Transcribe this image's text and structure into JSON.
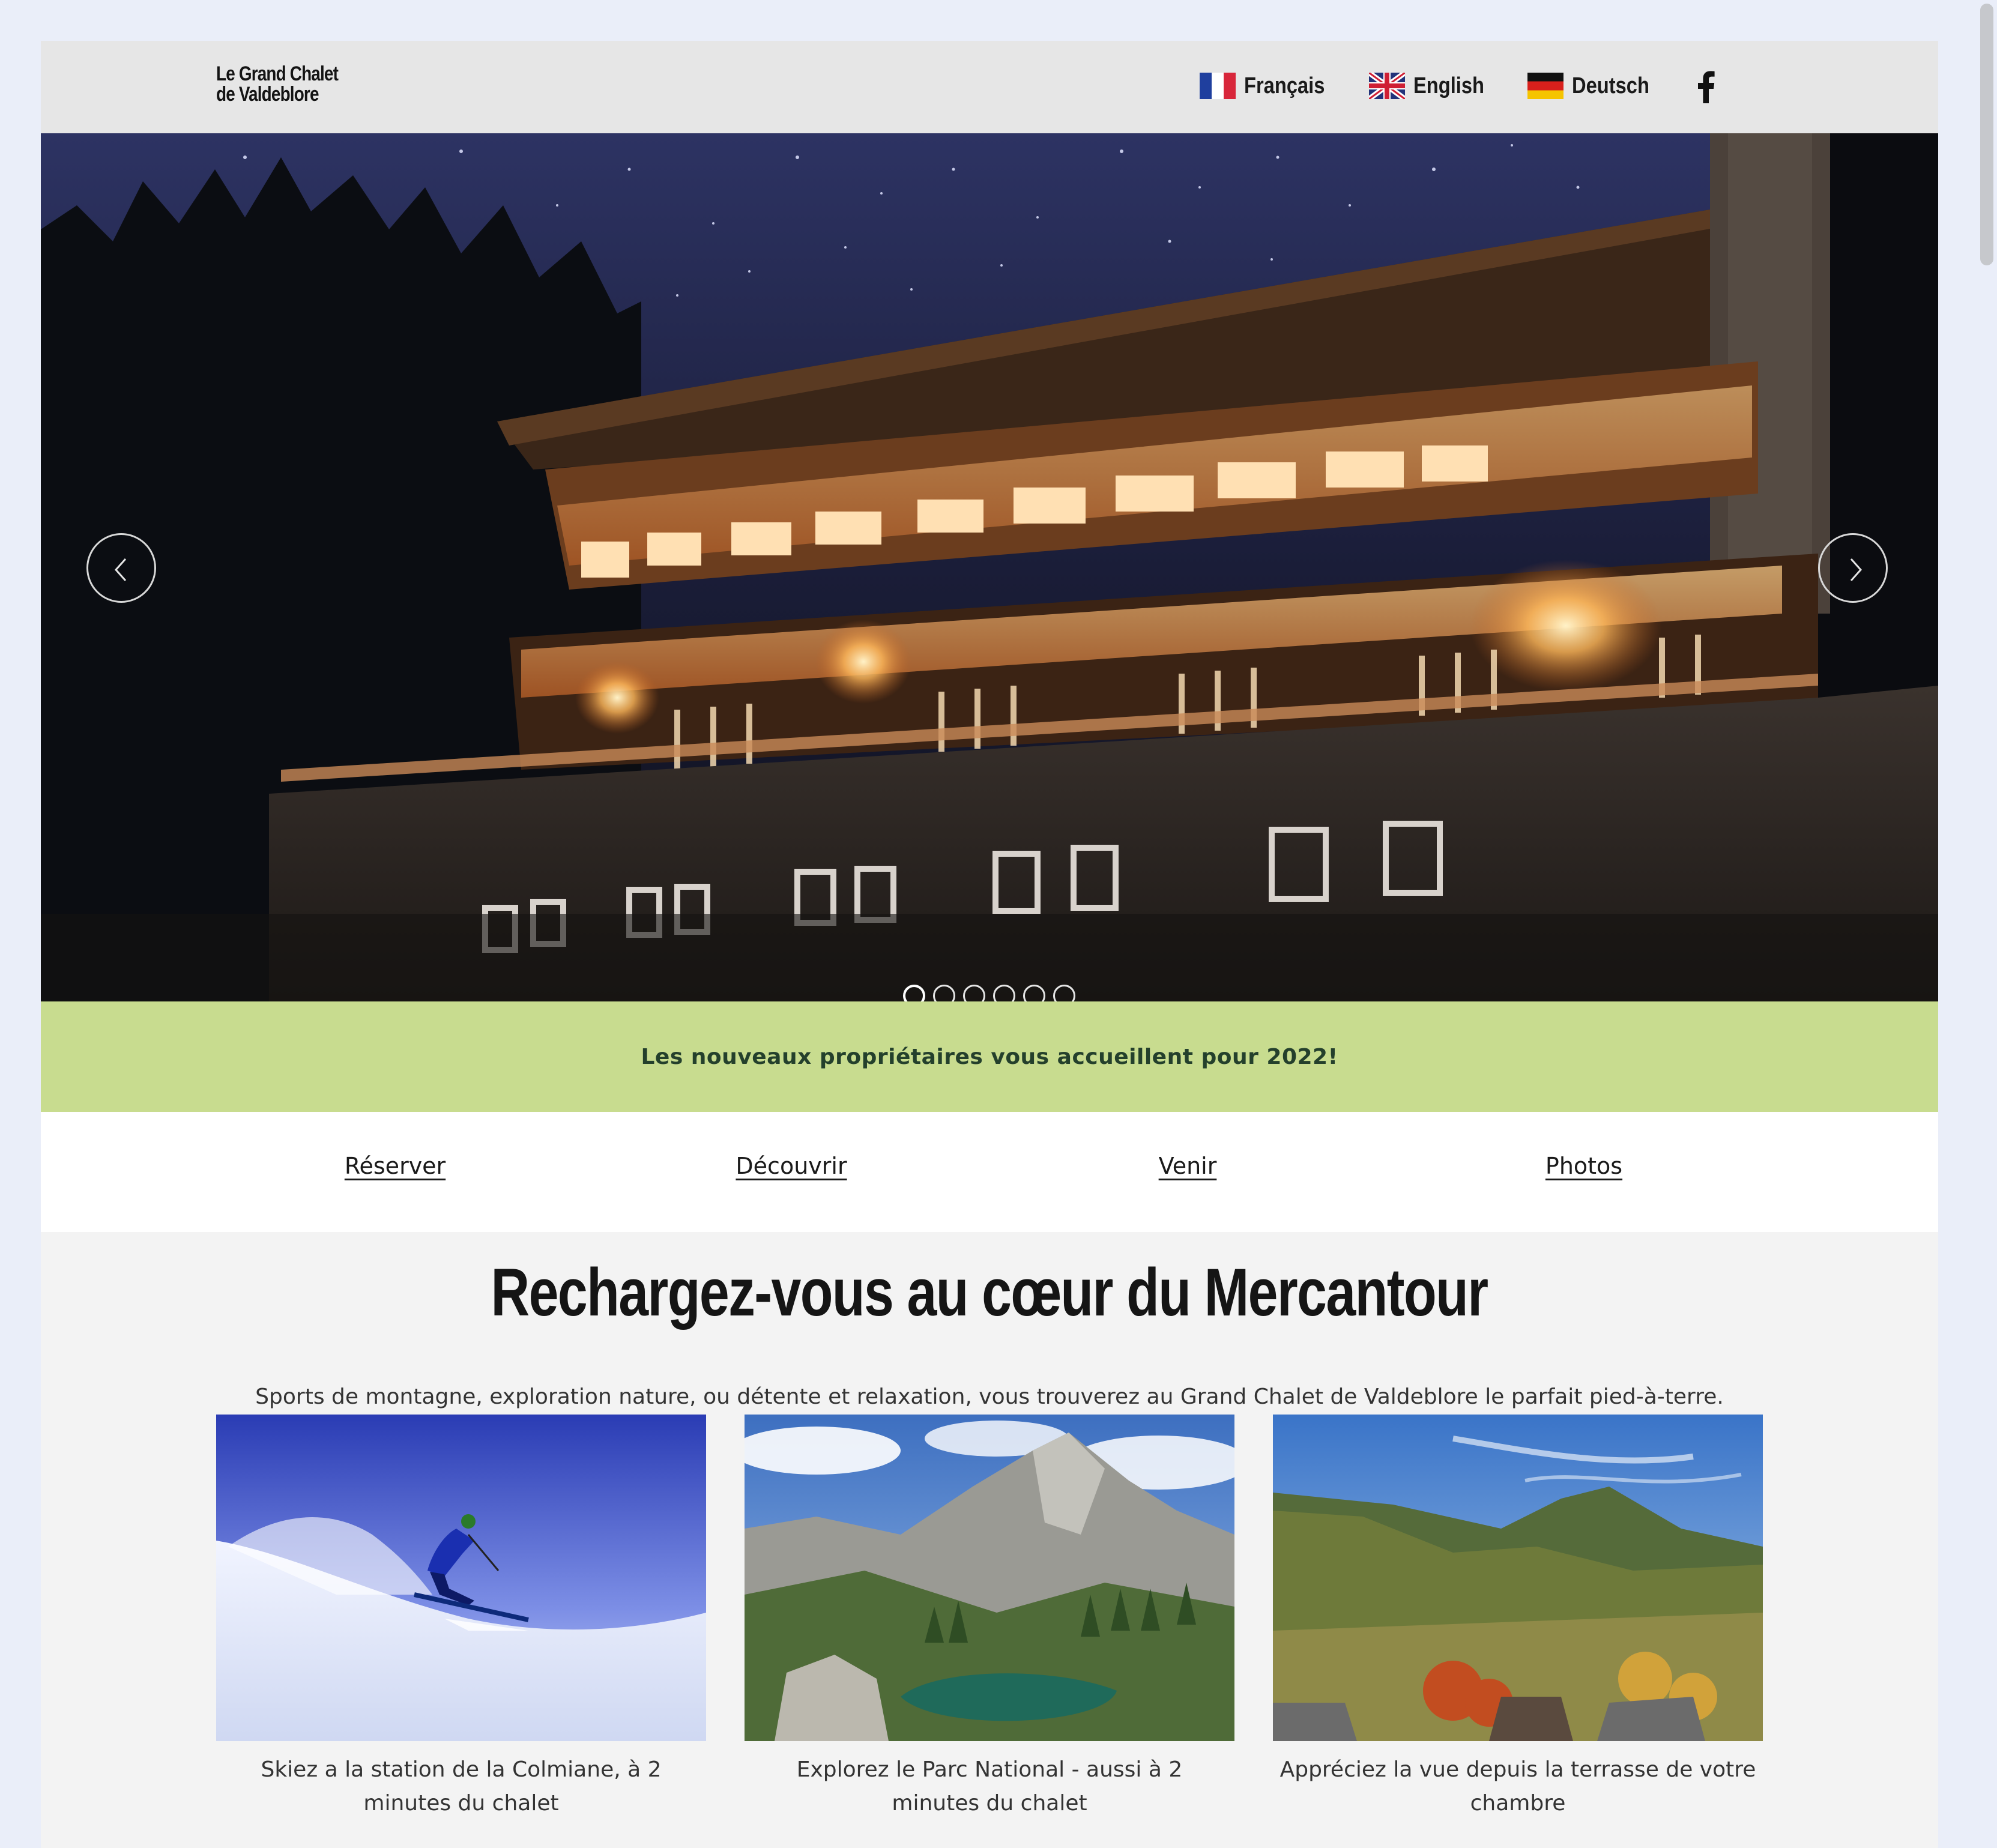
{
  "header": {
    "logo_line1": "Le Grand Chalet",
    "logo_line2": "de Valdeblore",
    "languages": [
      {
        "label": "Français",
        "flag": "flag-fr-icon"
      },
      {
        "label": "English",
        "flag": "flag-uk-icon"
      },
      {
        "label": "Deutsch",
        "flag": "flag-de-icon"
      }
    ],
    "social_icon": "facebook-icon"
  },
  "hero": {
    "prev_icon": "chevron-left-icon",
    "next_icon": "chevron-right-icon",
    "slide_count": 6,
    "active_slide": 1
  },
  "banner": {
    "text": "Les nouveaux propriétaires vous accueillent pour 2022!",
    "background": "#c8dc8f"
  },
  "nav": {
    "items": [
      {
        "label": "Réserver"
      },
      {
        "label": "Découvrir"
      },
      {
        "label": "Venir"
      },
      {
        "label": "Photos"
      }
    ]
  },
  "main": {
    "headline": "Rechargez-vous au cœur du Mercantour",
    "subheadline": "Sports de montagne, exploration nature, ou détente et relaxation, vous trouverez au Grand Chalet de Valdeblore le parfait pied-à-terre.",
    "cards": [
      {
        "caption": "Skiez a la station de la Colmiane, à 2 minutes du chalet"
      },
      {
        "caption": "Explorez le Parc National - aussi à 2 minutes du chalet"
      },
      {
        "caption": "Appréciez la vue depuis la terrasse de votre chambre"
      }
    ]
  }
}
